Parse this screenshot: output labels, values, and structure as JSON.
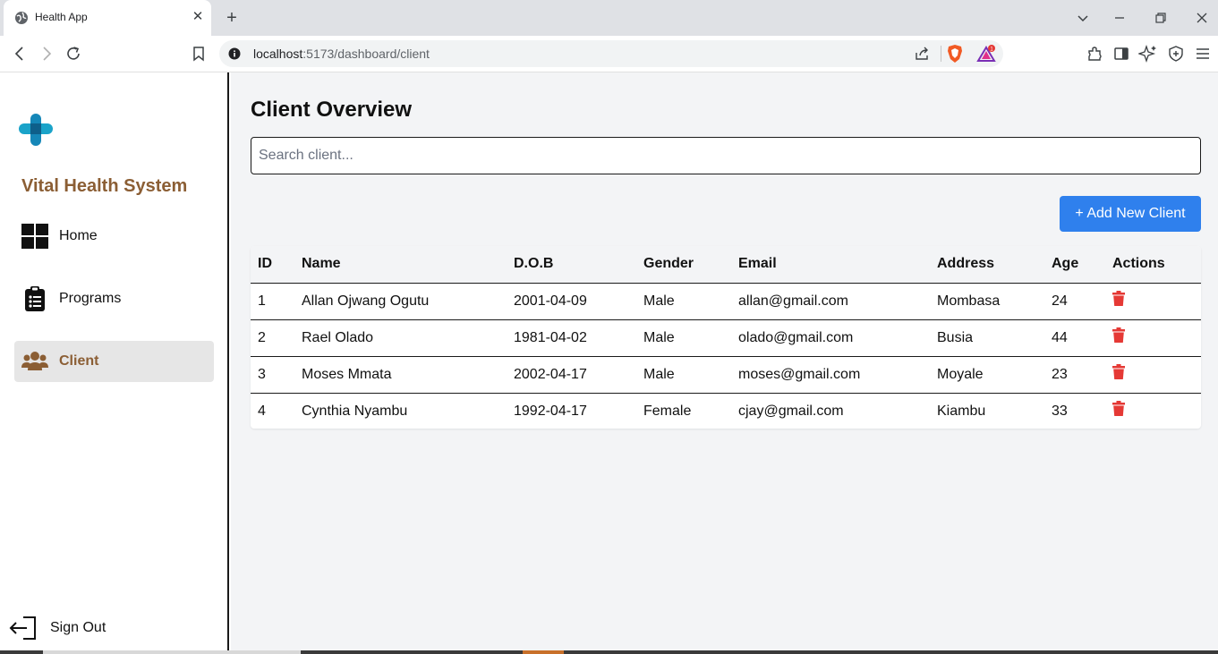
{
  "browser": {
    "tab_title": "Health App",
    "tab_close": "✕",
    "new_tab": "+",
    "url_host": "localhost",
    "url_rest": ":5173/dashboard/client",
    "rewards_badge": "1"
  },
  "sidebar": {
    "brand": "Vital Health System",
    "items": [
      {
        "label": "Home",
        "icon": "grid-icon"
      },
      {
        "label": "Programs",
        "icon": "clipboard-list-icon"
      },
      {
        "label": "Client",
        "icon": "users-icon",
        "active": true
      }
    ],
    "sign_out": "Sign Out"
  },
  "main": {
    "title": "Client Overview",
    "search_placeholder": "Search client...",
    "add_button": "+ Add New Client",
    "table": {
      "columns": [
        "ID",
        "Name",
        "D.O.B",
        "Gender",
        "Email",
        "Address",
        "Age",
        "Actions"
      ],
      "rows": [
        [
          "1",
          "Allan Ojwang Ogutu",
          "2001-04-09",
          "Male",
          "allan@gmail.com",
          "Mombasa",
          "24"
        ],
        [
          "2",
          "Rael Olado",
          "1981-04-02",
          "Male",
          "olado@gmail.com",
          "Busia",
          "44"
        ],
        [
          "3",
          "Moses Mmata",
          "2002-04-17",
          "Male",
          "moses@gmail.com",
          "Moyale",
          "23"
        ],
        [
          "4",
          "Cynthia Nyambu",
          "1992-04-17",
          "Female",
          "cjay@gmail.com",
          "Kiambu",
          "33"
        ]
      ]
    }
  },
  "colors": {
    "brand": "#8b5e34",
    "primary_button": "#2f80ed",
    "delete": "#e53935",
    "main_bg": "#f3f4f6"
  }
}
